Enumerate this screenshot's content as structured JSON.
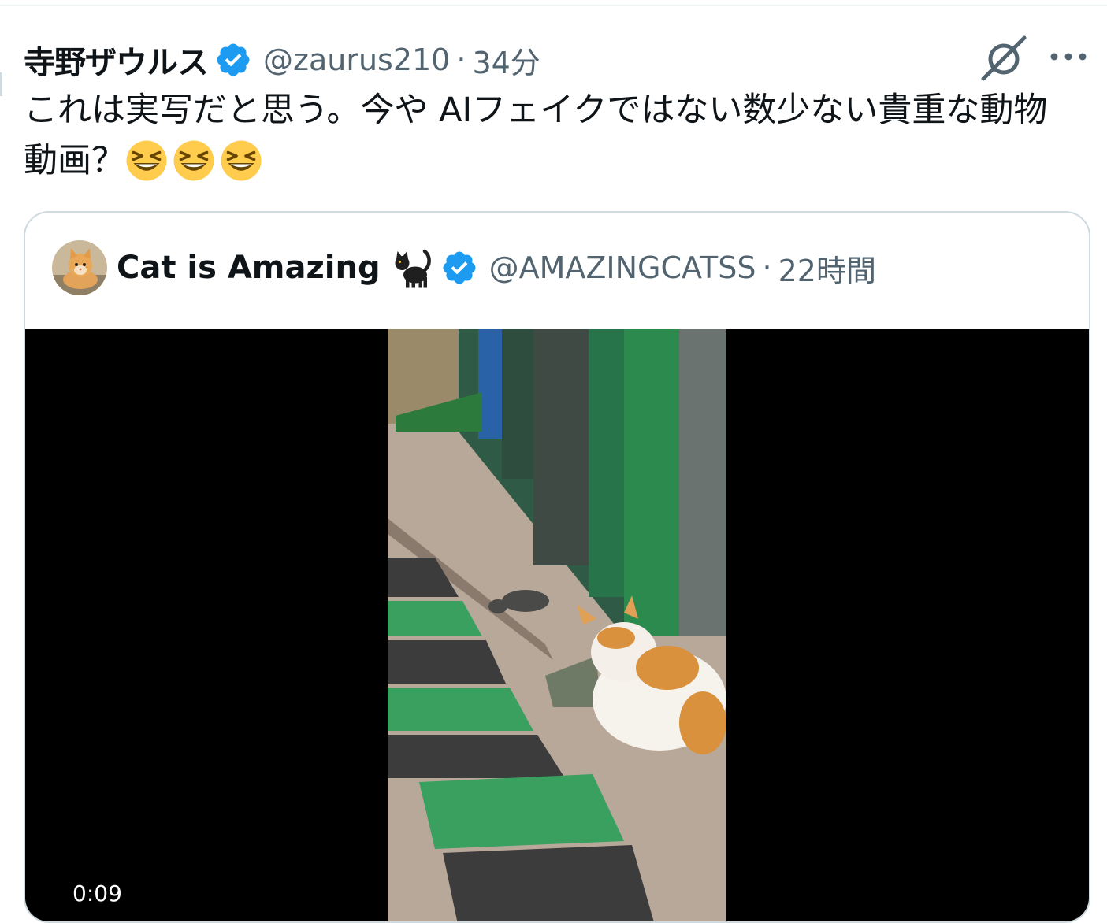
{
  "tweet": {
    "author_name": "寺野ザウルス",
    "handle": "@zaurus210",
    "separator": "·",
    "time_ago": "34分",
    "text": "これは実写だと思う。今や AIフェイクではない数少ない貴重な動物動画？",
    "emojis": [
      "grinning-squinting-face",
      "grinning-squinting-face",
      "grinning-squinting-face"
    ]
  },
  "actions": {
    "grok_icon": "grok-icon",
    "more_icon": "more-horizontal-icon"
  },
  "quote": {
    "author_name": "Cat is Amazing",
    "name_emoji": "black-cat",
    "handle": "@AMAZINGCATSS",
    "separator": "·",
    "time_ago": "22時間"
  },
  "video": {
    "timestamp": "0:09"
  },
  "colors": {
    "verified_blue": "#1d9bf0",
    "text_primary": "#0f1419",
    "text_secondary": "#536471",
    "border": "#cfd9de"
  }
}
